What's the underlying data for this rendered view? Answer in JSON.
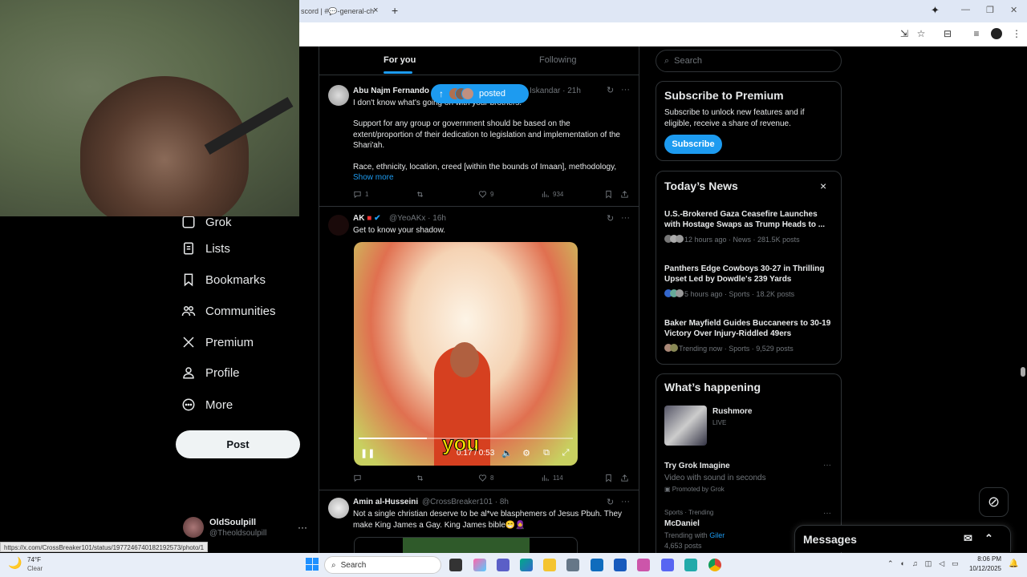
{
  "browser": {
    "tab_title": "scord | #💬-general-ch",
    "new_tab": "+",
    "close_tab": "×"
  },
  "nav": {
    "items": [
      {
        "label": "Grok",
        "icon": "grok-icon"
      },
      {
        "label": "Lists",
        "icon": "lists-icon"
      },
      {
        "label": "Bookmarks",
        "icon": "bookmark-icon"
      },
      {
        "label": "Communities",
        "icon": "communities-icon"
      },
      {
        "label": "Premium",
        "icon": "x-logo-icon"
      },
      {
        "label": "Profile",
        "icon": "profile-icon"
      },
      {
        "label": "More",
        "icon": "more-circle-icon"
      }
    ],
    "post_label": "Post"
  },
  "account": {
    "name": "OldSoulpill",
    "handle": "@Theoldsoulpill",
    "more": "···"
  },
  "status_url": "https://x.com/CrossBreaker101/status/1977246740182192573/photo/1",
  "feed": {
    "tabs": {
      "for_you": "For you",
      "following": "Following"
    },
    "posted_pill": "posted",
    "tweets": [
      {
        "name": "Abu Najm Fernando",
        "meta": "Iskandar · 21h",
        "text1": "I don't know what's going on with your brothers.",
        "text2": "Support for any group or government should be based on the extent/proportion of their dedication to legislation and implementation of the Shari'ah.",
        "text3": "Race, ethnicity, location, creed [within the bounds of Imaan], methodology,",
        "show_more": "Show more",
        "replies": "1",
        "reposts": "",
        "likes": "9",
        "views": "934"
      },
      {
        "name": "AK",
        "handle_meta": "@YeoAKx · 16h",
        "text": "Get to know your shadow.",
        "video_caption": "you",
        "video_time": "0:17 / 0:53",
        "video_progress": 0.32,
        "replies": "",
        "reposts": "",
        "likes": "8",
        "views": "114"
      },
      {
        "name": "Amin al-Husseini",
        "handle_meta": "@CrossBreaker101 · 8h",
        "text": "Not a single christian deserve to be al*ve blasphemers of Jesus Pbuh. They make King James a Gay. King James bible😁🧕"
      }
    ]
  },
  "right": {
    "search_placeholder": "Search",
    "premium": {
      "title": "Subscribe to Premium",
      "body": "Subscribe to unlock new features and if eligible, receive a share of revenue.",
      "button": "Subscribe"
    },
    "news": {
      "title": "Today’s News",
      "close": "×",
      "items": [
        {
          "title": "U.S.-Brokered Gaza Ceasefire Launches with Hostage Swaps as Trump Heads to ...",
          "meta": "12 hours ago · News · 281.5K posts"
        },
        {
          "title": "Panthers Edge Cowboys 30-27 in Thrilling Upset Led by Dowdle's 239 Yards",
          "meta": "5 hours ago · Sports · 18.2K posts"
        },
        {
          "title": "Baker Mayfield Guides Buccaneers to 30-19 Victory Over Injury-Riddled 49ers",
          "meta": "Trending now · Sports · 9,529 posts"
        }
      ]
    },
    "happening": {
      "title": "What’s happening",
      "live_title": "Rushmore",
      "live_label": "LIVE",
      "promo_title": "Try Grok Imagine",
      "promo_sub": "Video with sound in seconds",
      "promo_by": "Promoted by Grok",
      "trend_cat": "Sports · Trending",
      "trend_name": "McDaniel",
      "trend_with": "Trending with ",
      "trend_link": "Giler",
      "trend_posts": "4,653 posts"
    },
    "messages": "Messages"
  },
  "taskbar": {
    "weather_temp": "74°F",
    "weather_cond": "Clear",
    "search": "Search",
    "time": "8:06 PM",
    "date": "10/12/2025"
  },
  "colors": {
    "accent": "#1d9bf0",
    "bg": "#000000",
    "border": "#2f3336",
    "muted": "#71767b"
  }
}
